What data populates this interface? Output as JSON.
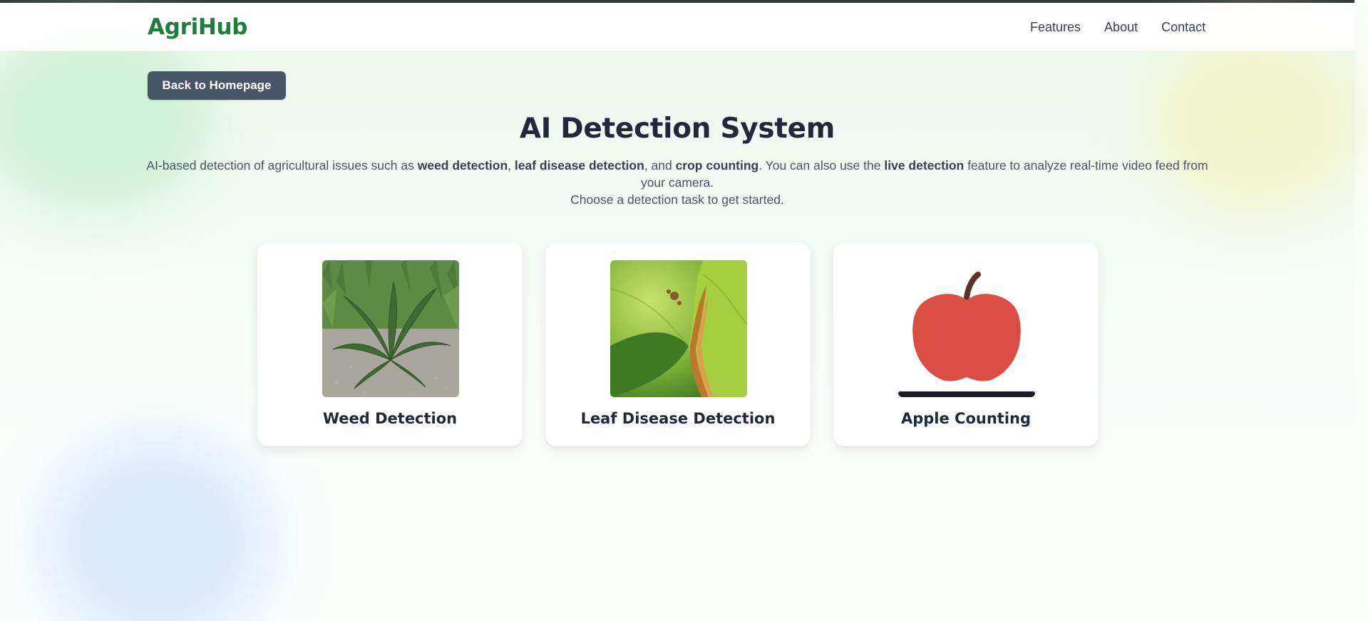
{
  "header": {
    "logo": "AgriHub",
    "nav": [
      "Features",
      "About",
      "Contact"
    ]
  },
  "back_button": "Back to Homepage",
  "hero": {
    "title": "AI Detection System",
    "desc_intro": "AI-based detection of agricultural issues such as ",
    "term_weed": "weed detection",
    "sep_comma": ", ",
    "term_leaf": "leaf disease detection",
    "sep_and": ", and ",
    "term_crop": "crop counting",
    "desc_mid": ". You can also use the ",
    "term_live": "live detection",
    "desc_end": " feature to analyze real-time video feed from your camera.",
    "desc_line2": "Choose a detection task to get started."
  },
  "cards": [
    {
      "label": "Weed Detection",
      "icon": "weed-photo"
    },
    {
      "label": "Leaf Disease Detection",
      "icon": "leaf-disease-photo"
    },
    {
      "label": "Apple Counting",
      "icon": "apple-icon"
    }
  ],
  "colors": {
    "brand": "#1e7f3d",
    "button": "#475569",
    "apple": "#d94f44"
  }
}
